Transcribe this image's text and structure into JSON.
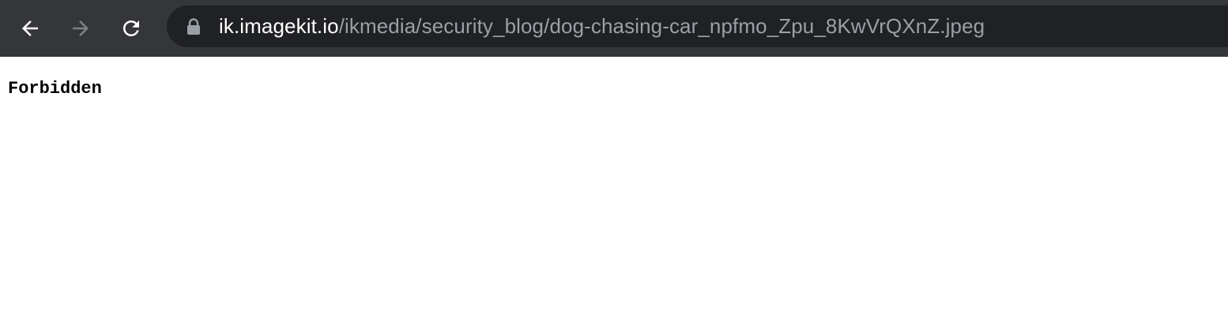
{
  "browser": {
    "toolbar": {
      "back_icon": "arrow-left-icon",
      "forward_icon": "arrow-right-icon",
      "reload_icon": "reload-icon"
    },
    "address_bar": {
      "security_icon": "lock-icon",
      "host": "ik.imagekit.io",
      "path": "/ikmedia/security_blog/dog-chasing-car_npfmo_Zpu_8KwVrQXnZ.jpeg"
    },
    "colors": {
      "toolbar_bg": "#35363a",
      "omnibox_bg": "#202124",
      "host_text": "#ffffff",
      "path_text": "#9aa0a6"
    }
  },
  "page": {
    "body_text": "Forbidden"
  }
}
